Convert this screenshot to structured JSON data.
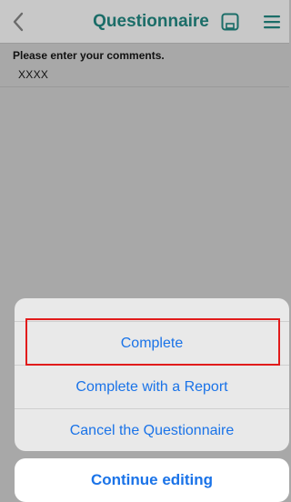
{
  "header": {
    "title": "Questionnaire",
    "back_icon": "chevron-left-icon",
    "save_icon": "save-icon",
    "menu_icon": "hamburger-menu-icon",
    "accent_color": "#1b6d68"
  },
  "form": {
    "comment_label": "Please enter your comments.",
    "comment_value": "XXXX"
  },
  "action_sheet": {
    "items": [
      {
        "label": "Complete"
      },
      {
        "label": "Complete with a Report"
      },
      {
        "label": "Cancel the Questionnaire"
      }
    ],
    "cancel_label": "Continue editing",
    "action_color": "#1a73e8",
    "highlight_color": "#e11b1b"
  }
}
